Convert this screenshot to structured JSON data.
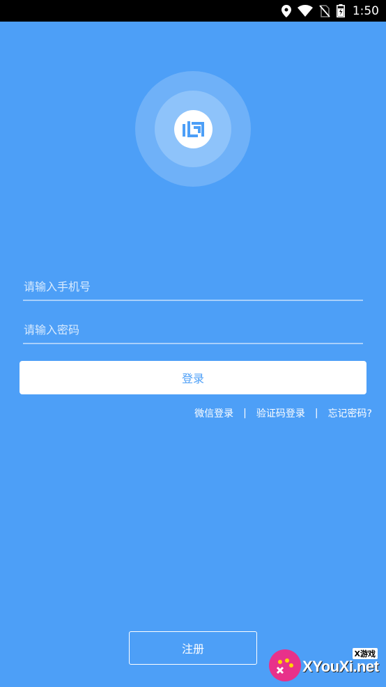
{
  "status_bar": {
    "time": "1:50",
    "icons": [
      "location-icon",
      "wifi-icon",
      "no-sim-icon",
      "battery-icon"
    ]
  },
  "logo": {
    "icon": "heart-mind-logo-icon",
    "brand_color": "#4d9ff7"
  },
  "form": {
    "phone_placeholder": "请输入手机号",
    "password_placeholder": "请输入密码",
    "login_label": "登录"
  },
  "links": {
    "wechat_login": "微信登录",
    "separator": "|",
    "sms_login": "验证码登录",
    "forgot_password": "忘记密码?"
  },
  "register": {
    "label": "注册"
  },
  "watermark": {
    "cn_label": "X游戏",
    "text": "XYouXi.net"
  }
}
